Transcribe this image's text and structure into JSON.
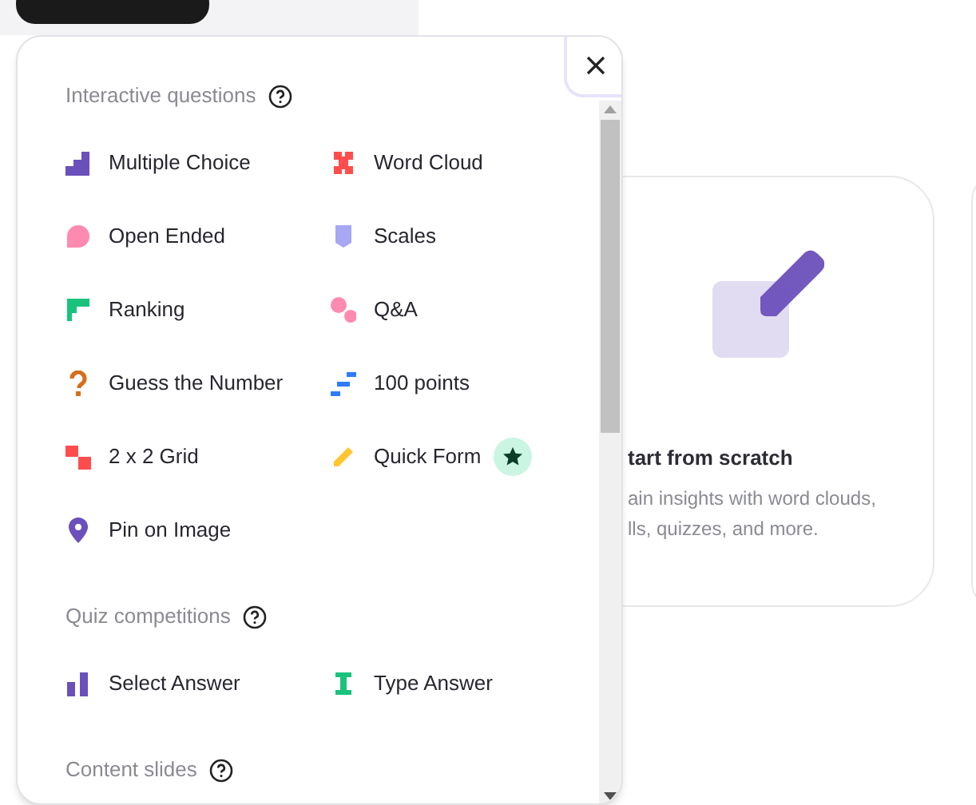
{
  "sections": [
    {
      "title": "Interactive questions",
      "items": [
        {
          "label": "Multiple Choice",
          "kind": "bars",
          "starred": false
        },
        {
          "label": "Word Cloud",
          "kind": "cloud",
          "starred": false
        },
        {
          "label": "Open Ended",
          "kind": "bubble",
          "starred": false
        },
        {
          "label": "Scales",
          "kind": "shield",
          "starred": false
        },
        {
          "label": "Ranking",
          "kind": "ranking",
          "starred": false
        },
        {
          "label": "Q&A",
          "kind": "dots",
          "starred": false
        },
        {
          "label": "Guess the Number",
          "kind": "question",
          "starred": false
        },
        {
          "label": "100 points",
          "kind": "steps",
          "starred": false
        },
        {
          "label": "2 x 2 Grid",
          "kind": "grid",
          "starred": false
        },
        {
          "label": "Quick Form",
          "kind": "pencil",
          "starred": true
        },
        {
          "label": "Pin on Image",
          "kind": "pin",
          "starred": false
        }
      ]
    },
    {
      "title": "Quiz competitions",
      "items": [
        {
          "label": "Select Answer",
          "kind": "twobars",
          "starred": false
        },
        {
          "label": "Type Answer",
          "kind": "cursor",
          "starred": false
        }
      ]
    },
    {
      "title": "Content slides"
    }
  ],
  "card": {
    "title": "tart from scratch",
    "lines": [
      "ain insights with word clouds,",
      "lls, quizzes, and more."
    ]
  }
}
